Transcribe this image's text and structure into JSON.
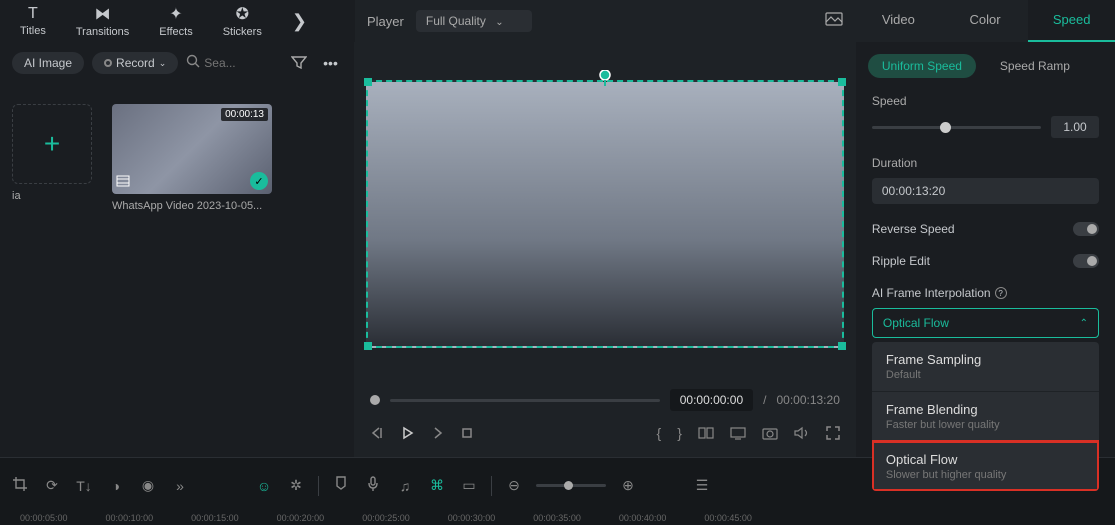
{
  "toolbar": {
    "titles": "Titles",
    "transitions": "Transitions",
    "effects": "Effects",
    "stickers": "Stickers"
  },
  "player": {
    "label": "Player",
    "quality": "Full Quality",
    "current_time": "00:00:00:00",
    "total_time": "00:00:13:20",
    "separator": "/"
  },
  "media": {
    "ai_image": "AI Image",
    "record": "Record",
    "search_placeholder": "Sea...",
    "clip_duration": "00:00:13",
    "clip_name": "WhatsApp Video 2023-10-05...",
    "truncated_label": "ia"
  },
  "right_tabs": {
    "video": "Video",
    "color": "Color",
    "speed": "Speed"
  },
  "speed_panel": {
    "uniform": "Uniform Speed",
    "ramp": "Speed Ramp",
    "speed_label": "Speed",
    "speed_value": "1.00",
    "duration_label": "Duration",
    "duration_value": "00:00:13:20",
    "reverse": "Reverse Speed",
    "ripple": "Ripple Edit",
    "interp_label": "AI Frame Interpolation",
    "selected": "Optical Flow",
    "options": [
      {
        "title": "Frame Sampling",
        "sub": "Default"
      },
      {
        "title": "Frame Blending",
        "sub": "Faster but lower quality"
      },
      {
        "title": "Optical Flow",
        "sub": "Slower but higher quality"
      }
    ]
  },
  "ruler": [
    "00:00:05:00",
    "00:00:10:00",
    "00:00:15:00",
    "00:00:20:00",
    "00:00:25:00",
    "00:00:30:00",
    "00:00:35:00",
    "00:00:40:00",
    "00:00:45:00"
  ]
}
